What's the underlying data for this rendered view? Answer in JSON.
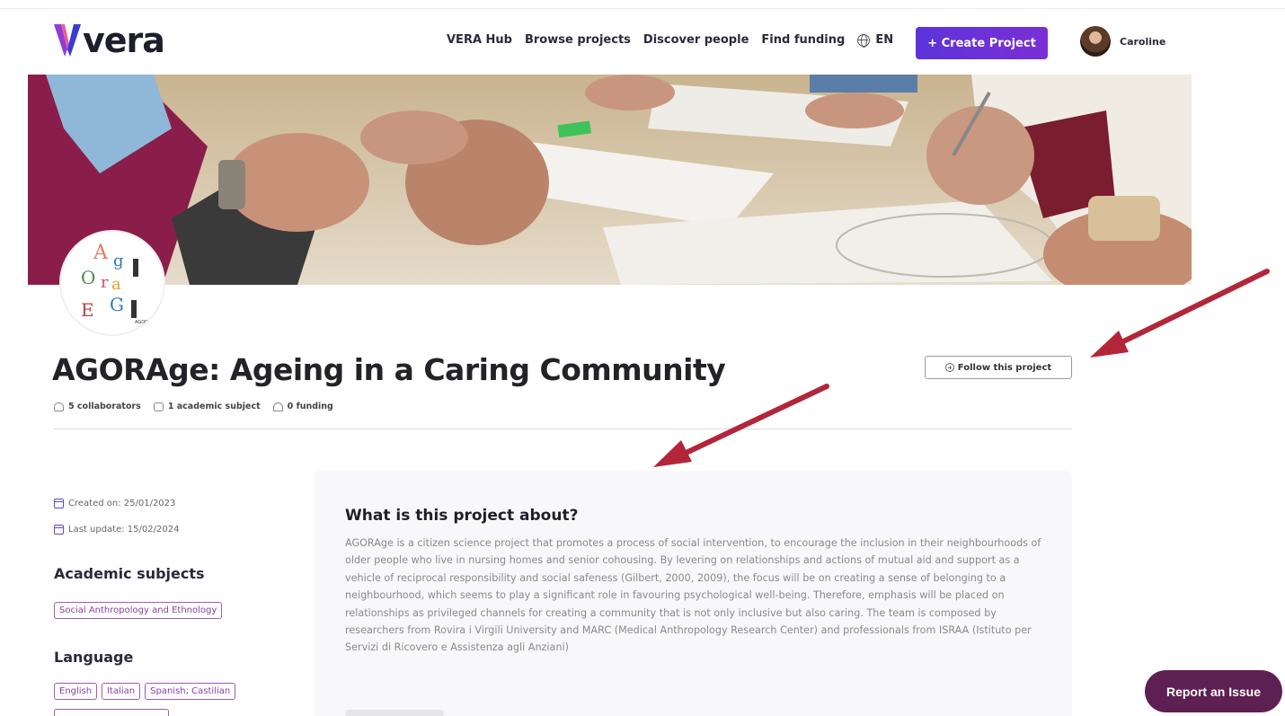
{
  "brand": {
    "name": "vera"
  },
  "nav": {
    "items": [
      "VERA Hub",
      "Browse projects",
      "Discover people",
      "Find funding"
    ],
    "language": "EN",
    "create_label": "+ Create Project",
    "user_name": "Caroline"
  },
  "project": {
    "title": "AGORAge: Ageing in a Caring Community",
    "follow_label": "Follow this project",
    "stats": {
      "collaborators": "5 collaborators",
      "subjects": "1 academic subject",
      "funding": "0 funding"
    },
    "logo_text": "AGORAge",
    "created": "Created on: 25/01/2023",
    "updated": "Last update: 15/02/2024"
  },
  "sidebar": {
    "academic_heading": "Academic subjects",
    "academic_tags": [
      "Social Anthropology and Ethnology"
    ],
    "language_heading": "Language",
    "language_tags": [
      "English",
      "Italian",
      "Spanish; Castilian"
    ]
  },
  "about": {
    "heading": "What is this project about?",
    "body": "AGORAge is a citizen science project that promotes a process of social intervention, to encourage the inclusion in their neighbourhoods of older people who live in nursing homes and senior cohousing. By levering on relationships and actions of mutual aid and support as a vehicle of reciprocal responsibility and social safeness (Gilbert, 2000, 2009), the focus will be on creating a sense of belonging to a neighbourhood, which seems to play a significant role in favouring psychological well-being. Therefore, emphasis will be placed on relationships as privileged channels for creating a community that is not only inclusive but also caring. The team is composed by researchers from Rovira i Virgili University and MARC (Medical Anthropology Research Center) and professionals from ISRAA (Istituto per Servizi di Ricovero e Assistenza agli Anziani)"
  },
  "report_label": "Report an Issue",
  "colors": {
    "primary": "#5b34d9",
    "tag": "#a05ab5",
    "report": "#5e2052",
    "arrow": "#b3263a"
  }
}
